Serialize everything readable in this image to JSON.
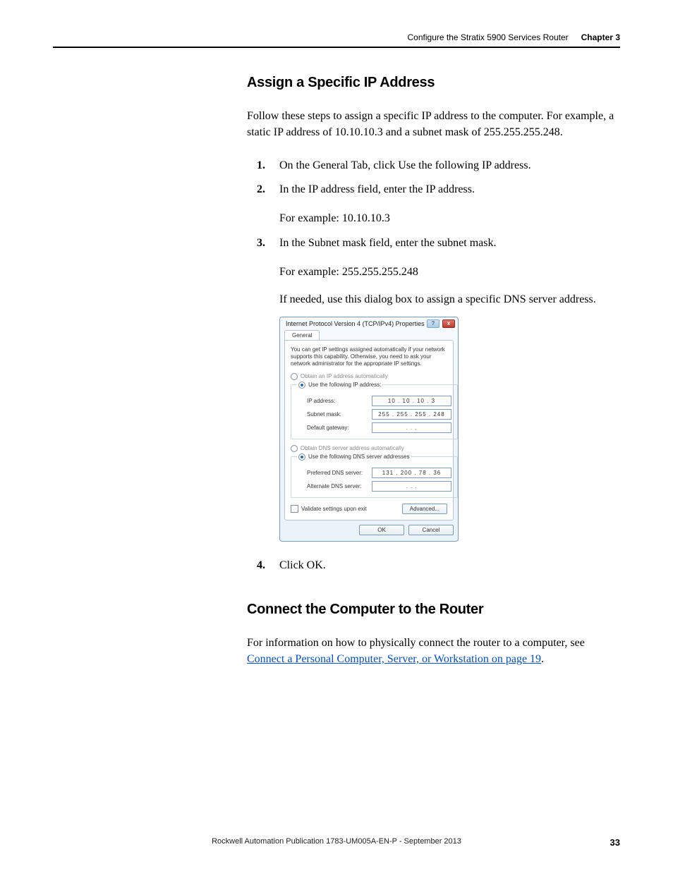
{
  "header": {
    "title": "Configure the Stratix 5900 Services Router",
    "chapter_label": "Chapter 3"
  },
  "section1": {
    "heading": "Assign a Specific IP Address",
    "intro": "Follow these steps to assign a specific IP address to the computer. For example, a static IP address of 10.10.10.3 and a subnet mask of 255.255.255.248.",
    "step1": "On the General Tab, click Use the following IP address.",
    "step2": "In the IP address field, enter the IP address.",
    "step2_example": "For example: 10.10.10.3",
    "step3": "In the Subnet mask field, enter the subnet mask.",
    "step3_example": "For example: 255.255.255.248",
    "step3_note": "If needed, use this dialog box to assign a specific DNS server address.",
    "step4": "Click OK."
  },
  "dialog": {
    "title": "Internet Protocol Version 4 (TCP/IPv4) Properties",
    "close_x": "x",
    "help_q": "?",
    "tab_general": "General",
    "desc": "You can get IP settings assigned automatically if your network supports this capability. Otherwise, you need to ask your network administrator for the appropriate IP settings.",
    "opt_auto_ip": "Obtain an IP address automatically",
    "opt_use_ip": "Use the following IP address:",
    "lbl_ip": "IP address:",
    "val_ip": "10 . 10 . 10 .  3",
    "lbl_mask": "Subnet mask:",
    "val_mask": "255 . 255 . 255 . 248",
    "lbl_gw": "Default gateway:",
    "val_gw": ".        .        .",
    "opt_auto_dns": "Obtain DNS server address automatically",
    "opt_use_dns": "Use the following DNS server addresses",
    "lbl_pdns": "Preferred DNS server:",
    "val_pdns": "131 . 200 . 78 . 36",
    "lbl_adns": "Alternate DNS server:",
    "val_adns": ".        .        .",
    "validate": "Validate settings upon exit",
    "btn_advanced": "Advanced...",
    "btn_ok": "OK",
    "btn_cancel": "Cancel"
  },
  "section2": {
    "heading": "Connect the Computer to the Router",
    "body_pre": "For information on how to physically connect the router to a computer, see ",
    "link_text": "Connect a Personal Computer, Server, or Workstation on page 19",
    "body_post": "."
  },
  "footer": {
    "publication": "Rockwell Automation Publication 1783-UM005A-EN-P - September 2013",
    "page": "33"
  }
}
